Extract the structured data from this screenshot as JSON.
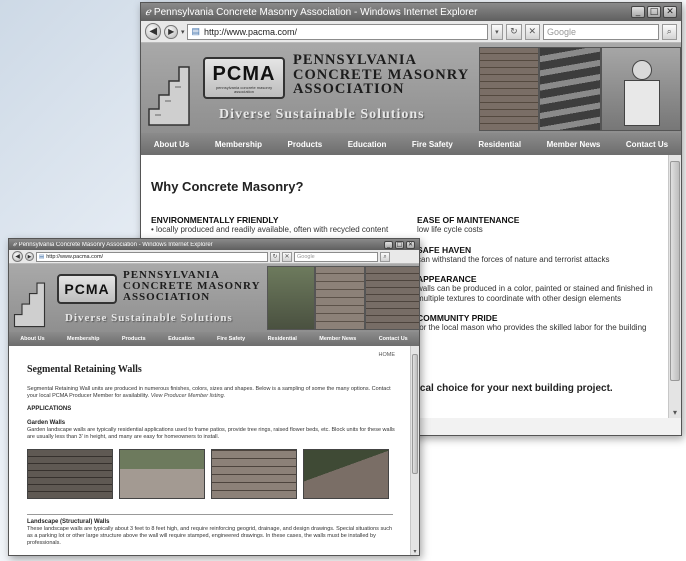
{
  "back_window": {
    "title": "Pennsylvania Concrete Masonry Association - Windows Internet Explorer",
    "url": "http://www.pacma.com/",
    "search_placeholder": "Google",
    "logo": "PCMA",
    "logo_sub": "pennsylvania concrete masonry association",
    "org_lines": [
      "PENNSYLVANIA",
      "CONCRETE MASONRY",
      "ASSOCIATION"
    ],
    "tagline": "Diverse Sustainable Solutions",
    "nav": [
      "About Us",
      "Membership",
      "Products",
      "Education",
      "Fire Safety",
      "Residential",
      "Member News",
      "Contact Us"
    ],
    "heading": "Why Concrete Masonry?",
    "left": [
      {
        "title": "ENVIRONMENTALLY FRIENDLY",
        "text": "• locally produced and readily available, often with recycled content"
      }
    ],
    "right": [
      {
        "title": "EASE OF MAINTENANCE",
        "text": "low life cycle costs"
      },
      {
        "title": "SAFE HAVEN",
        "text": "can withstand the forces of nature and terrorist attacks"
      },
      {
        "title": "APPEARANCE",
        "text": "walls can be produced in a color, painted or stained and finished in multiple textures to coordinate with other design elements"
      },
      {
        "title": "COMMUNITY PRIDE",
        "text": "for the local mason who provides the skilled labor for the building"
      }
    ],
    "closing": "local choice for your next building project."
  },
  "front_window": {
    "title": "Pennsylvania Concrete Masonry Association - Windows Internet Explorer",
    "url": "http://www.pacma.com/",
    "search_placeholder": "Google",
    "logo": "PCMA",
    "org_lines": [
      "PENNSYLVANIA",
      "CONCRETE MASONRY",
      "ASSOCIATION"
    ],
    "tagline": "Diverse Sustainable Solutions",
    "nav": [
      "About Us",
      "Membership",
      "Products",
      "Education",
      "Fire Safety",
      "Residential",
      "Member News",
      "Contact Us"
    ],
    "breadcrumb": "HOME",
    "heading": "Segmental Retaining Walls",
    "intro": "Segmental Retaining Wall units are produced in numerous finishes, colors, sizes and shapes. Below is a sampling of some the many options. Contact your local PCMA Producer Member for availability.",
    "intro_link": "View Producer Member listing.",
    "applications_label": "APPLICATIONS",
    "garden_title": "Garden Walls",
    "garden_text": "Garden landscape walls are typically residential applications used to frame patios, provide tree rings, raised flower beds, etc. Block units for these walls are usually less than 3' in height, and many are easy for homeowners to install.",
    "landscape_title": "Landscape (Structural) Walls",
    "landscape_text": "These landscape walls are typically about 3 feet to 8 feet high, and require reinforcing geogrid, drainage, and design drawings. Special situations such as a parking lot or other large structure above the wall will require stamped, engineered drawings. In these cases, the walls must be installed by professionals."
  }
}
